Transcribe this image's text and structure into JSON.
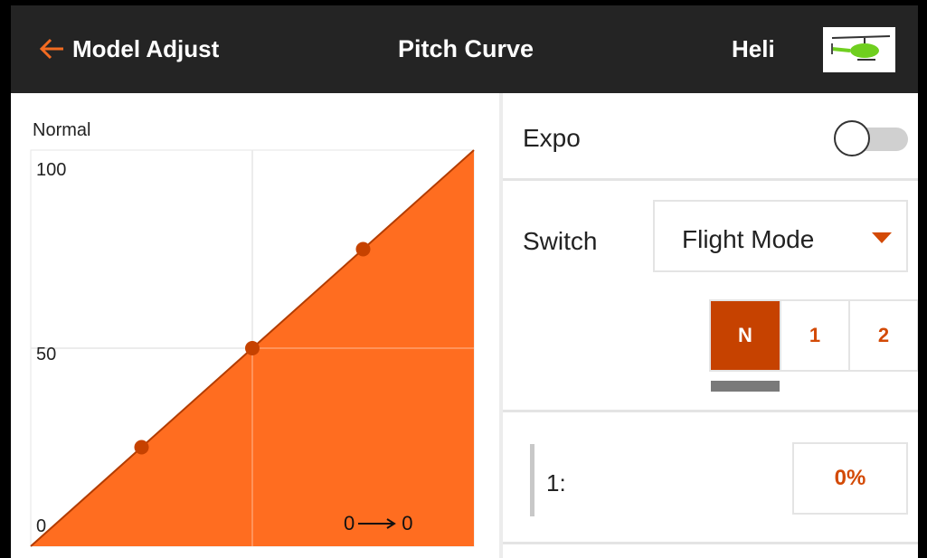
{
  "header": {
    "back_label": "Model Adjust",
    "title": "Pitch Curve",
    "model_name": "Heli",
    "model_image": "helicopter-thumbnail"
  },
  "graph": {
    "curve_name": "Normal",
    "y_tick_labels": [
      "100",
      "50",
      "0"
    ],
    "io_input": "0",
    "io_output": "0",
    "fill_color": "#ff6d20",
    "point_color": "#c64200"
  },
  "chart_data": {
    "type": "area",
    "x": [
      0,
      25,
      50,
      75,
      100
    ],
    "values": [
      0,
      25,
      50,
      75,
      100
    ],
    "control_points_x": [
      25,
      50,
      75
    ],
    "ylim": [
      0,
      100
    ],
    "xlim": [
      0,
      100
    ],
    "grid": true
  },
  "settings": {
    "expo_label": "Expo",
    "expo_enabled": false,
    "switch_label": "Switch",
    "switch_value": "Flight Mode",
    "flight_modes": [
      {
        "label": "N",
        "active": true
      },
      {
        "label": "1",
        "active": false
      },
      {
        "label": "2",
        "active": false
      }
    ],
    "point_label": "1:",
    "point_value": "0%",
    "accent_color": "#d34a06"
  },
  "icons": {
    "back": "arrow-left-icon",
    "dropdown": "triangle-down-icon",
    "io": "arrow-right-icon"
  }
}
